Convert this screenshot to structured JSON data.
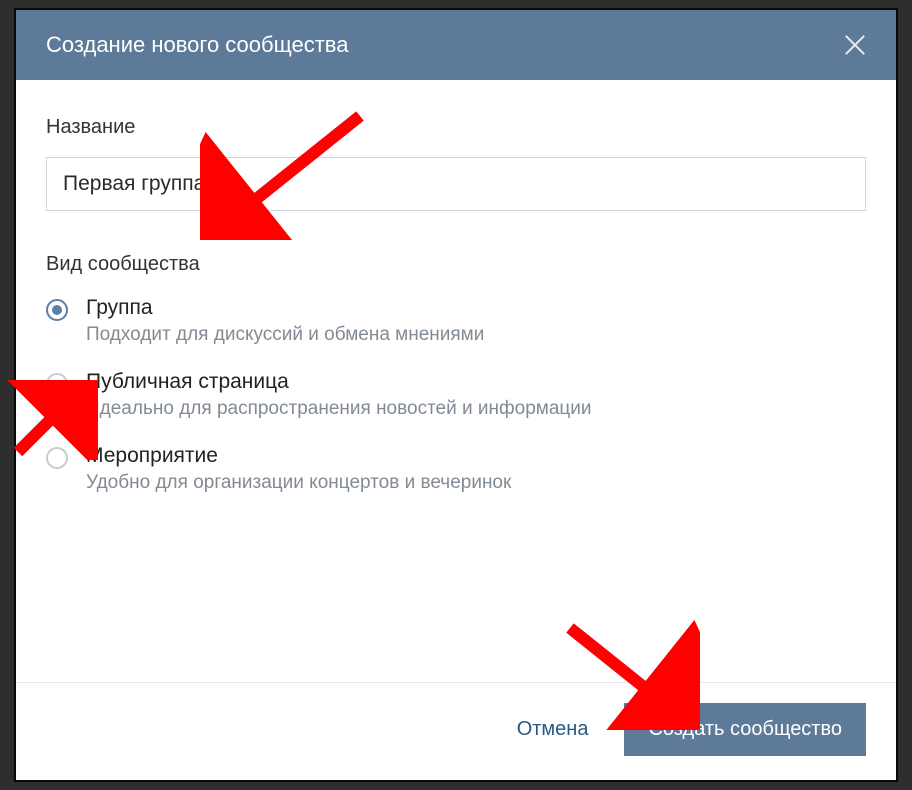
{
  "header": {
    "title": "Создание нового сообщества"
  },
  "form": {
    "name_label": "Название",
    "name_value": "Первая группа",
    "type_label": "Вид сообщества",
    "options": [
      {
        "title": "Группа",
        "desc": "Подходит для дискуссий и обмена мнениями",
        "selected": true
      },
      {
        "title": "Публичная страница",
        "desc": "Идеально для распространения новостей и информации",
        "selected": false
      },
      {
        "title": "Мероприятие",
        "desc": "Удобно для организации концертов и вечеринок",
        "selected": false
      }
    ]
  },
  "footer": {
    "cancel": "Отмена",
    "create": "Создать сообщество"
  }
}
